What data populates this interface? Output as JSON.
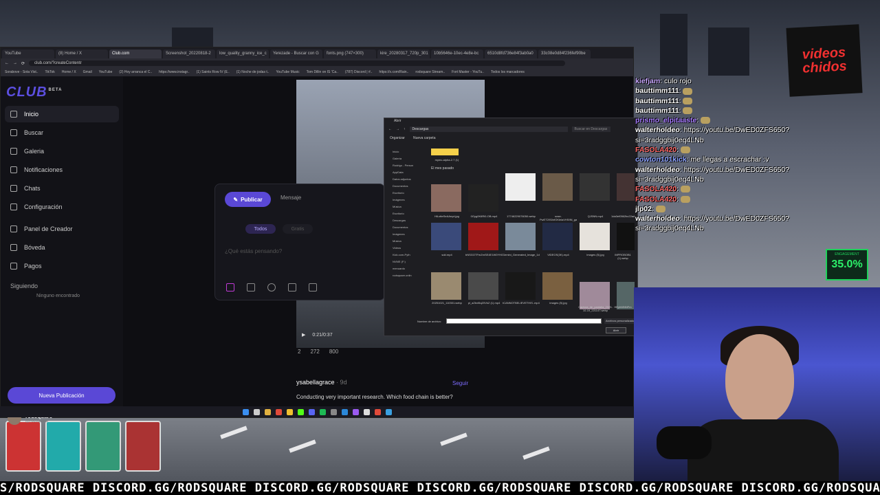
{
  "browser": {
    "tabs": [
      "YouTube",
      "(8) Home / X",
      "Club.com",
      "Screenshot_20220818-2",
      "low_quality_granny_ice_c",
      "Yerezade - Buscar con G",
      "fonts.png (747×300)",
      "kire_20280317_720p_301",
      "10b5646e-10ec-4e8e-bc",
      "6510d8fd736e84f3ab0a0",
      "33c08e0d84f236fef90be"
    ],
    "active_tab": 2,
    "url": "club.com/?createContentr",
    "bookmarks": [
      "Sorabove - Sota Vist..",
      "TikTok",
      "Home / X",
      "Gmail",
      "YouTube",
      "(2) Hoy arranca el C..",
      "https://www.instagr..",
      "(1) Saints Row IV (E..",
      "(1) Noche de jodas t..",
      "YouTube Music",
      "Tom Dillin on IS 'Ca..",
      "(787) Discord | #..",
      "https://x.com/Rain..",
      "rodsquare Stream..",
      "Fort Master - YouTu..",
      "Todos los marcadores"
    ]
  },
  "sidebar": {
    "beta": "BETA",
    "items": [
      "Inicio",
      "Buscar",
      "Galeria",
      "Notificaciones",
      "Chats",
      "Configuración",
      "Panel de Creador",
      "Bóveda",
      "Pagos"
    ],
    "following": "Siguiendo",
    "none_found": "Ninguno encontrado",
    "new_post": "Nueva Publicación",
    "user_name": "rodsquare",
    "user_handle": "@rodsquare"
  },
  "composer": {
    "publish": "Publicar",
    "message": "Mensaje",
    "audience": "Todos",
    "price": "Gratis",
    "placeholder": "¿Qué estás pensando?"
  },
  "feed": {
    "time": "0:21/0:37",
    "comments": "2",
    "likes": "272",
    "views": "800",
    "post_user": "ysabellagrace",
    "post_time": "· 9d",
    "follow": "Seguir",
    "post_text": "Conducting very important research. Which food chain is better?"
  },
  "dialog": {
    "title": "Abrir",
    "path": "Descargas",
    "search": "Buscar en Descargas",
    "organize": "Organizar",
    "new_folder": "Nueva carpeta",
    "group": "El mes pasado",
    "folder_caption": "mymc-alpha-2.7 (1)",
    "tree": [
      "Inicio",
      "Galería",
      "Rodrigo - Person",
      "AppData",
      "Datos adjuntos",
      "Documentos",
      "Escritorio",
      "Imágenes",
      "Música",
      "Escritorio",
      "Descargas",
      "Documentos",
      "Imágenes",
      "Música",
      "Videos",
      "Kick.com-Pyth",
      "NVME (F:)",
      "menuardo",
      "rodsquare.onlin"
    ],
    "files": [
      "HiLotteSeAAnyd.jpg",
      "0Gyg0K6Ri0-OB.mp4",
      "17746229076050.webp",
      "sose-PwET2IS0nfOKlelaVHSfIN_gan_01.shwfj.sosssetshgijjelf.dmsmdbs.mp4",
      "QJSNN.mp4",
      "1da3ef0562bc22ad0fc5.mp4",
      "sdd.mp4",
      "bNSGOTFmZmSE4E1W0YHGAeVnZrf..webp",
      "Gemini_Generated_Image_1d6c0tc1d0c..webp",
      "VIDEOS(3K).mp4",
      "images (5).jpg",
      "IMPROBOB1 (1).webp",
      "20251021_110301.webp",
      "pl_aZbvt5qZ0VkZ (1).mp4",
      "tCANNOTBELIEVETHIS..mp4",
      "images (5).jpg",
      "Captura_de_pantalla_2025-10-19_221147.webp",
      "HEyhWNNFm"
    ],
    "filename_label": "Nombre de archivo:",
    "filetype": "Archivos personalizados",
    "open": "Abrir"
  },
  "chat": [
    {
      "user": "kiefjam",
      "msg": "culo rojo",
      "color": "#c8a8ff"
    },
    {
      "user": "bauttimm111",
      "msg": "",
      "color": "#ffffff"
    },
    {
      "user": "bauttimm111",
      "msg": "",
      "color": "#ffffff"
    },
    {
      "user": "bauttimm111",
      "msg": "",
      "color": "#ffffff"
    },
    {
      "user": "prismo_elpitaaste",
      "msg": "",
      "color": "#a77bff"
    },
    {
      "user": "walterholdeo",
      "msg": "https://youtu.be/DwED0ZFS650?",
      "color": "#ffffff"
    },
    {
      "user": "",
      "msg": "si=3radggbij0eq4LNb",
      "color": "#ffffff"
    },
    {
      "user": "FASOLA420",
      "msg": "",
      "color": "#ff6a6a"
    },
    {
      "user": "cowton101kick",
      "msg": "me llegas a escrachar :v",
      "color": "#8aa0ff"
    },
    {
      "user": "walterholdeo",
      "msg": "https://youtu.be/DwED0ZFS650?",
      "color": "#ffffff"
    },
    {
      "user": "",
      "msg": "si=3radggbij0eq4LNb",
      "color": "#ffffff"
    },
    {
      "user": "FASOLA420",
      "msg": "",
      "color": "#ff6a6a"
    },
    {
      "user": "FASOLA420",
      "msg": "",
      "color": "#ff6a6a"
    },
    {
      "user": "jlp02",
      "msg": "",
      "color": "#ffffff"
    },
    {
      "user": "walterholdeo",
      "msg": "https://youtu.be/DwED0ZFS650?",
      "color": "#ffffff"
    },
    {
      "user": "",
      "msg": "si=3radggbij0eq4LNb",
      "color": "#ffffff"
    }
  ],
  "overlay": {
    "logo_text": "videos chidos",
    "engagement_label": "ENGAGEMENT",
    "engagement_value": "35.0%",
    "ticker": "S/RODSQUARE DISCORD.GG/RODSQUARE DISCORD.GG/RODSQUARE DISCORD.GG/RODSQUARE DISCORD.GG/RODSQUARE DISCORD.GG/RODSQUARE DISCORD"
  }
}
